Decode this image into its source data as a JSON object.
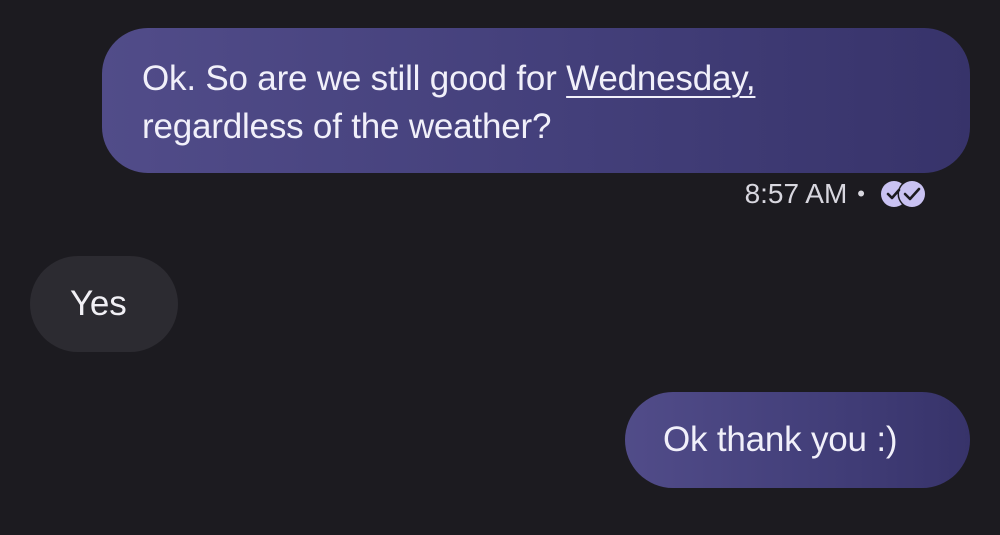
{
  "messages": [
    {
      "direction": "sent",
      "text_before_link": "Ok. So are we still good for ",
      "link_text": "Wednesday,",
      "text_after_link": "regardless of the weather?",
      "timestamp": "8:57 AM",
      "separator": "•",
      "status_icon": "read-receipt-double-check-icon"
    },
    {
      "direction": "received",
      "text": "Yes"
    },
    {
      "direction": "sent",
      "text": "Ok thank you :)"
    }
  ],
  "colors": {
    "background": "#1c1b20",
    "sent_bubble": "#4a4582",
    "received_bubble": "#2c2b31",
    "read_icon": "#c9c2f2"
  }
}
